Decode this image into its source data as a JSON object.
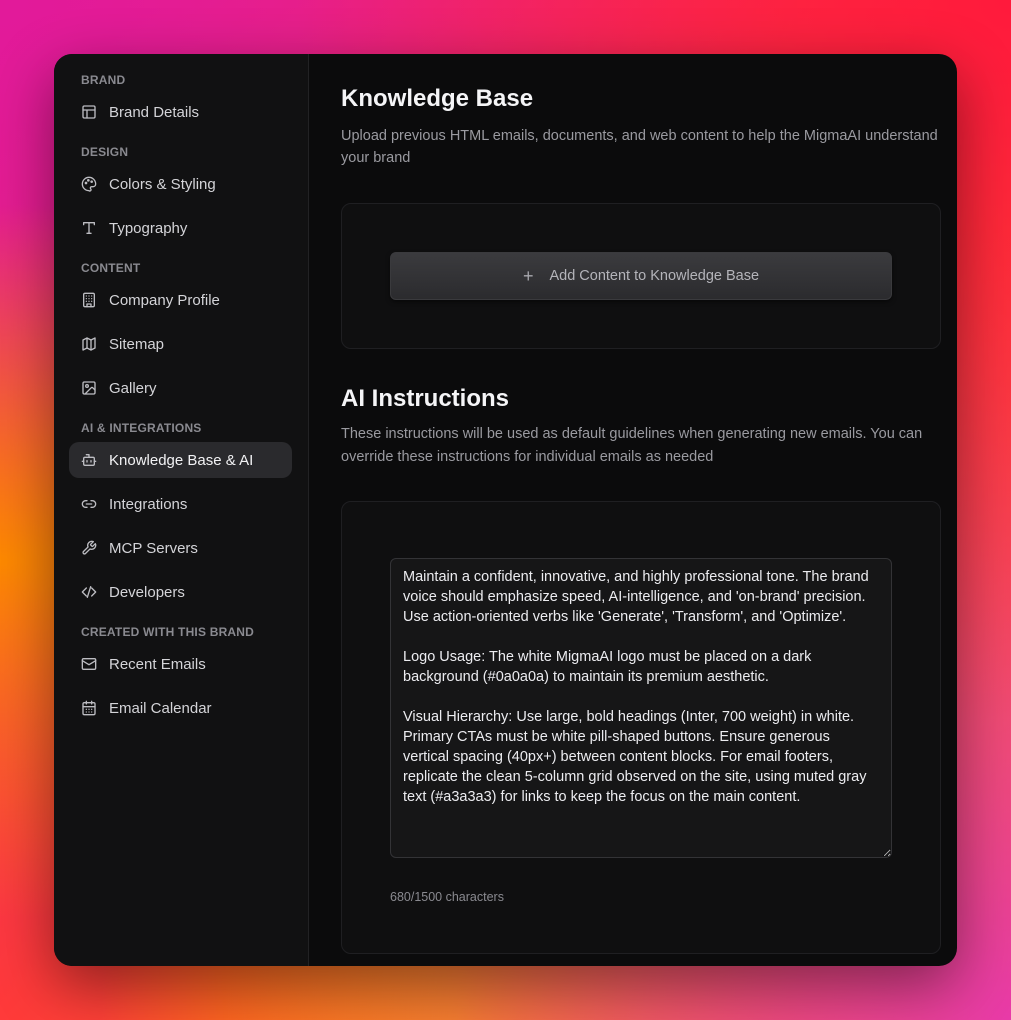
{
  "sidebar": {
    "sections": [
      {
        "label": "BRAND",
        "items": [
          {
            "label": "Brand Details",
            "icon": "layout-icon"
          }
        ]
      },
      {
        "label": "DESIGN",
        "items": [
          {
            "label": "Colors & Styling",
            "icon": "palette-icon"
          },
          {
            "label": "Typography",
            "icon": "type-icon"
          }
        ]
      },
      {
        "label": "CONTENT",
        "items": [
          {
            "label": "Company Profile",
            "icon": "building-icon"
          },
          {
            "label": "Sitemap",
            "icon": "map-icon"
          },
          {
            "label": "Gallery",
            "icon": "image-icon"
          }
        ]
      },
      {
        "label": "AI & INTEGRATIONS",
        "items": [
          {
            "label": "Knowledge Base & AI",
            "icon": "bot-icon",
            "active": true
          },
          {
            "label": "Integrations",
            "icon": "link-icon"
          },
          {
            "label": "MCP Servers",
            "icon": "wrench-icon"
          },
          {
            "label": "Developers",
            "icon": "code-icon"
          }
        ]
      },
      {
        "label": "CREATED WITH THIS BRAND",
        "items": [
          {
            "label": "Recent Emails",
            "icon": "mail-icon"
          },
          {
            "label": "Email Calendar",
            "icon": "calendar-icon"
          }
        ]
      }
    ]
  },
  "knowledge_base": {
    "title": "Knowledge Base",
    "description": "Upload previous HTML emails, documents, and web content to help the MigmaAI understand your brand",
    "add_button_label": "Add Content to Knowledge Base"
  },
  "ai_instructions": {
    "title": "AI Instructions",
    "description": "These instructions will be used as default guidelines when generating new emails. You can override these instructions for individual emails as needed",
    "value": "Maintain a confident, innovative, and highly professional tone. The brand voice should emphasize speed, AI-intelligence, and 'on-brand' precision. Use action-oriented verbs like 'Generate', 'Transform', and 'Optimize'.\n\nLogo Usage: The white MigmaAI logo must be placed on a dark background (#0a0a0a) to maintain its premium aesthetic.\n\nVisual Hierarchy: Use large, bold headings (Inter, 700 weight) in white. Primary CTAs must be white pill-shaped buttons. Ensure generous vertical spacing (40px+) between content blocks. For email footers, replicate the clean 5-column grid observed on the site, using muted gray text (#a3a3a3) for links to keep the focus on the main content.",
    "char_count": "680/1500 characters"
  }
}
